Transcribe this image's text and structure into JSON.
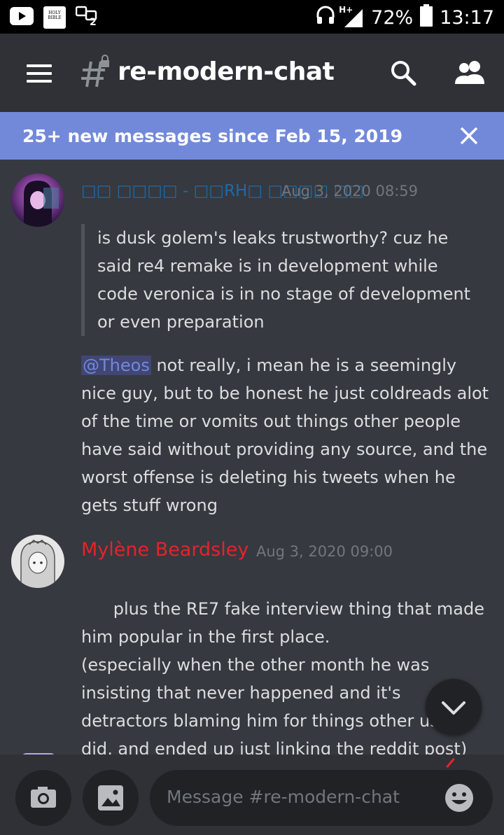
{
  "status_bar": {
    "network": "H+",
    "battery": "72%",
    "time": "13:17",
    "notification_icons": [
      "youtube-icon",
      "holy-bible-app-icon",
      "chat-notification-icon"
    ],
    "bible_icon_text": "HOLY BIBLE",
    "chat_icon_count": "2"
  },
  "header": {
    "channel_name": "re-modern-chat",
    "channel_icon": "locked-hash-icon"
  },
  "banner": {
    "text": "25+ new messages since Feb 15, 2019"
  },
  "messages": [
    {
      "author": "□□ □□□□ - □□RH□ □□□□ □□",
      "author_color": "#1f6aa5",
      "timestamp": "Aug 3, 2020 08:59",
      "quote": "is dusk golem's leaks trustworthy? cuz he said re4 remake is in development while code veronica is in no stage of development or even preparation",
      "mention": "@Theos",
      "text": " not really, i mean he is a seemingly nice guy, but to be honest he just coldreads alot of the time or vomits out things other people have said without providing any source, and the worst offense is deleting his tweets when he gets stuff wrong"
    },
    {
      "author": "Mylène Beardsley",
      "author_color": "#e3242b",
      "timestamp": "Aug 3, 2020 09:00",
      "text": "plus the RE7 fake interview thing that made him popular in the first place.\n(especially when the other month he was insisting that never happened and it's detractors blaming him for things other users did, and ended up just linking the reddit post)"
    }
  ],
  "composer": {
    "placeholder": "Message #re-modern-chat"
  },
  "colors": {
    "background": "#36393f",
    "header": "#2f3136",
    "banner": "#7289da",
    "input": "#202225"
  }
}
